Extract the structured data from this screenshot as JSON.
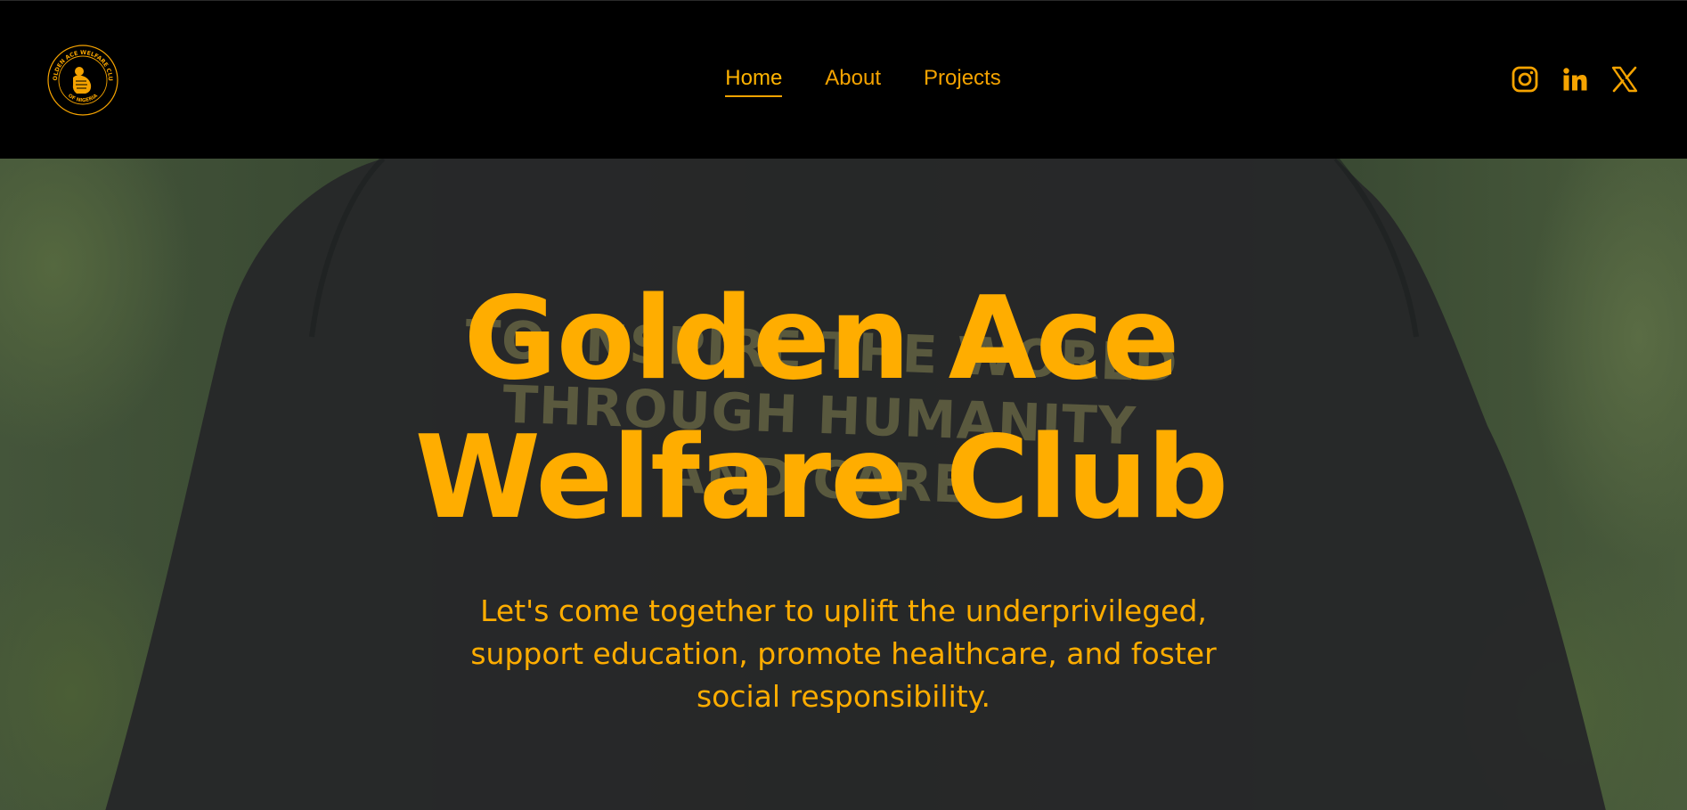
{
  "header": {
    "logo": {
      "ring_text_top": "GOLDEN ACE WELFARE CLUB",
      "ring_text_bottom": "OF NIGERIA"
    },
    "nav": [
      {
        "label": "Home",
        "active": true
      },
      {
        "label": "About",
        "active": false
      },
      {
        "label": "Projects",
        "active": false
      }
    ],
    "socials": [
      {
        "icon": "instagram-icon"
      },
      {
        "icon": "linkedin-icon"
      },
      {
        "icon": "x-twitter-icon"
      }
    ]
  },
  "hero": {
    "title_line1": "Golden Ace",
    "title_line2": "Welfare Club",
    "subtitle": "Let's come together to uplift the underprivileged, support education, promote healthcare, and foster social responsibility.",
    "background_print": {
      "line1": "TO INSPIRE THE WORLD",
      "line2": "THROUGH HUMANITY",
      "line3": "AND CARE"
    }
  },
  "colors": {
    "accent": "#ffad00",
    "header_bg": "#000000",
    "shirt": "#26282a"
  }
}
